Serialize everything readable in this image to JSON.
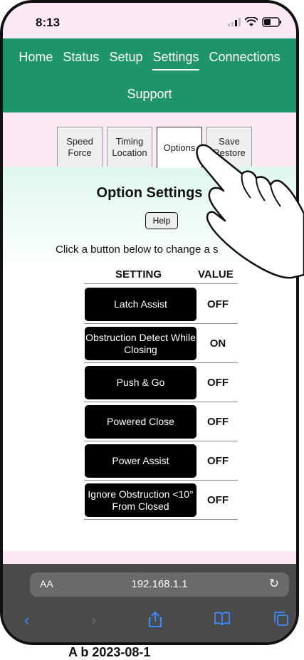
{
  "status_bar": {
    "time": "8:13"
  },
  "nav": {
    "row1": [
      "Home",
      "Status",
      "Setup",
      "Settings",
      "Connections"
    ],
    "active": "Settings",
    "row2": "Support"
  },
  "tabs": [
    {
      "line1": "Speed",
      "line2": "Force"
    },
    {
      "line1": "Timing",
      "line2": "Location"
    },
    {
      "line1": "Options",
      "line2": ""
    },
    {
      "line1": "Save",
      "line2": "Restore"
    }
  ],
  "page": {
    "title": "Option Settings",
    "help_label": "Help",
    "hint": "Click a button below to change a s",
    "col_setting": "SETTING",
    "col_value": "VALUE"
  },
  "settings": [
    {
      "label": "Latch Assist",
      "value": "OFF"
    },
    {
      "label": "Obstruction Detect While Closing",
      "value": "ON"
    },
    {
      "label": "Push & Go",
      "value": "OFF"
    },
    {
      "label": "Powered Close",
      "value": "OFF"
    },
    {
      "label": "Power Assist",
      "value": "OFF"
    },
    {
      "label": "Ignore Obstruction <10° From Closed",
      "value": "OFF"
    }
  ],
  "browser": {
    "text_size_label": "AA",
    "url": "192.168.1.1"
  },
  "footer_caption": "A          b  2023-08-1"
}
